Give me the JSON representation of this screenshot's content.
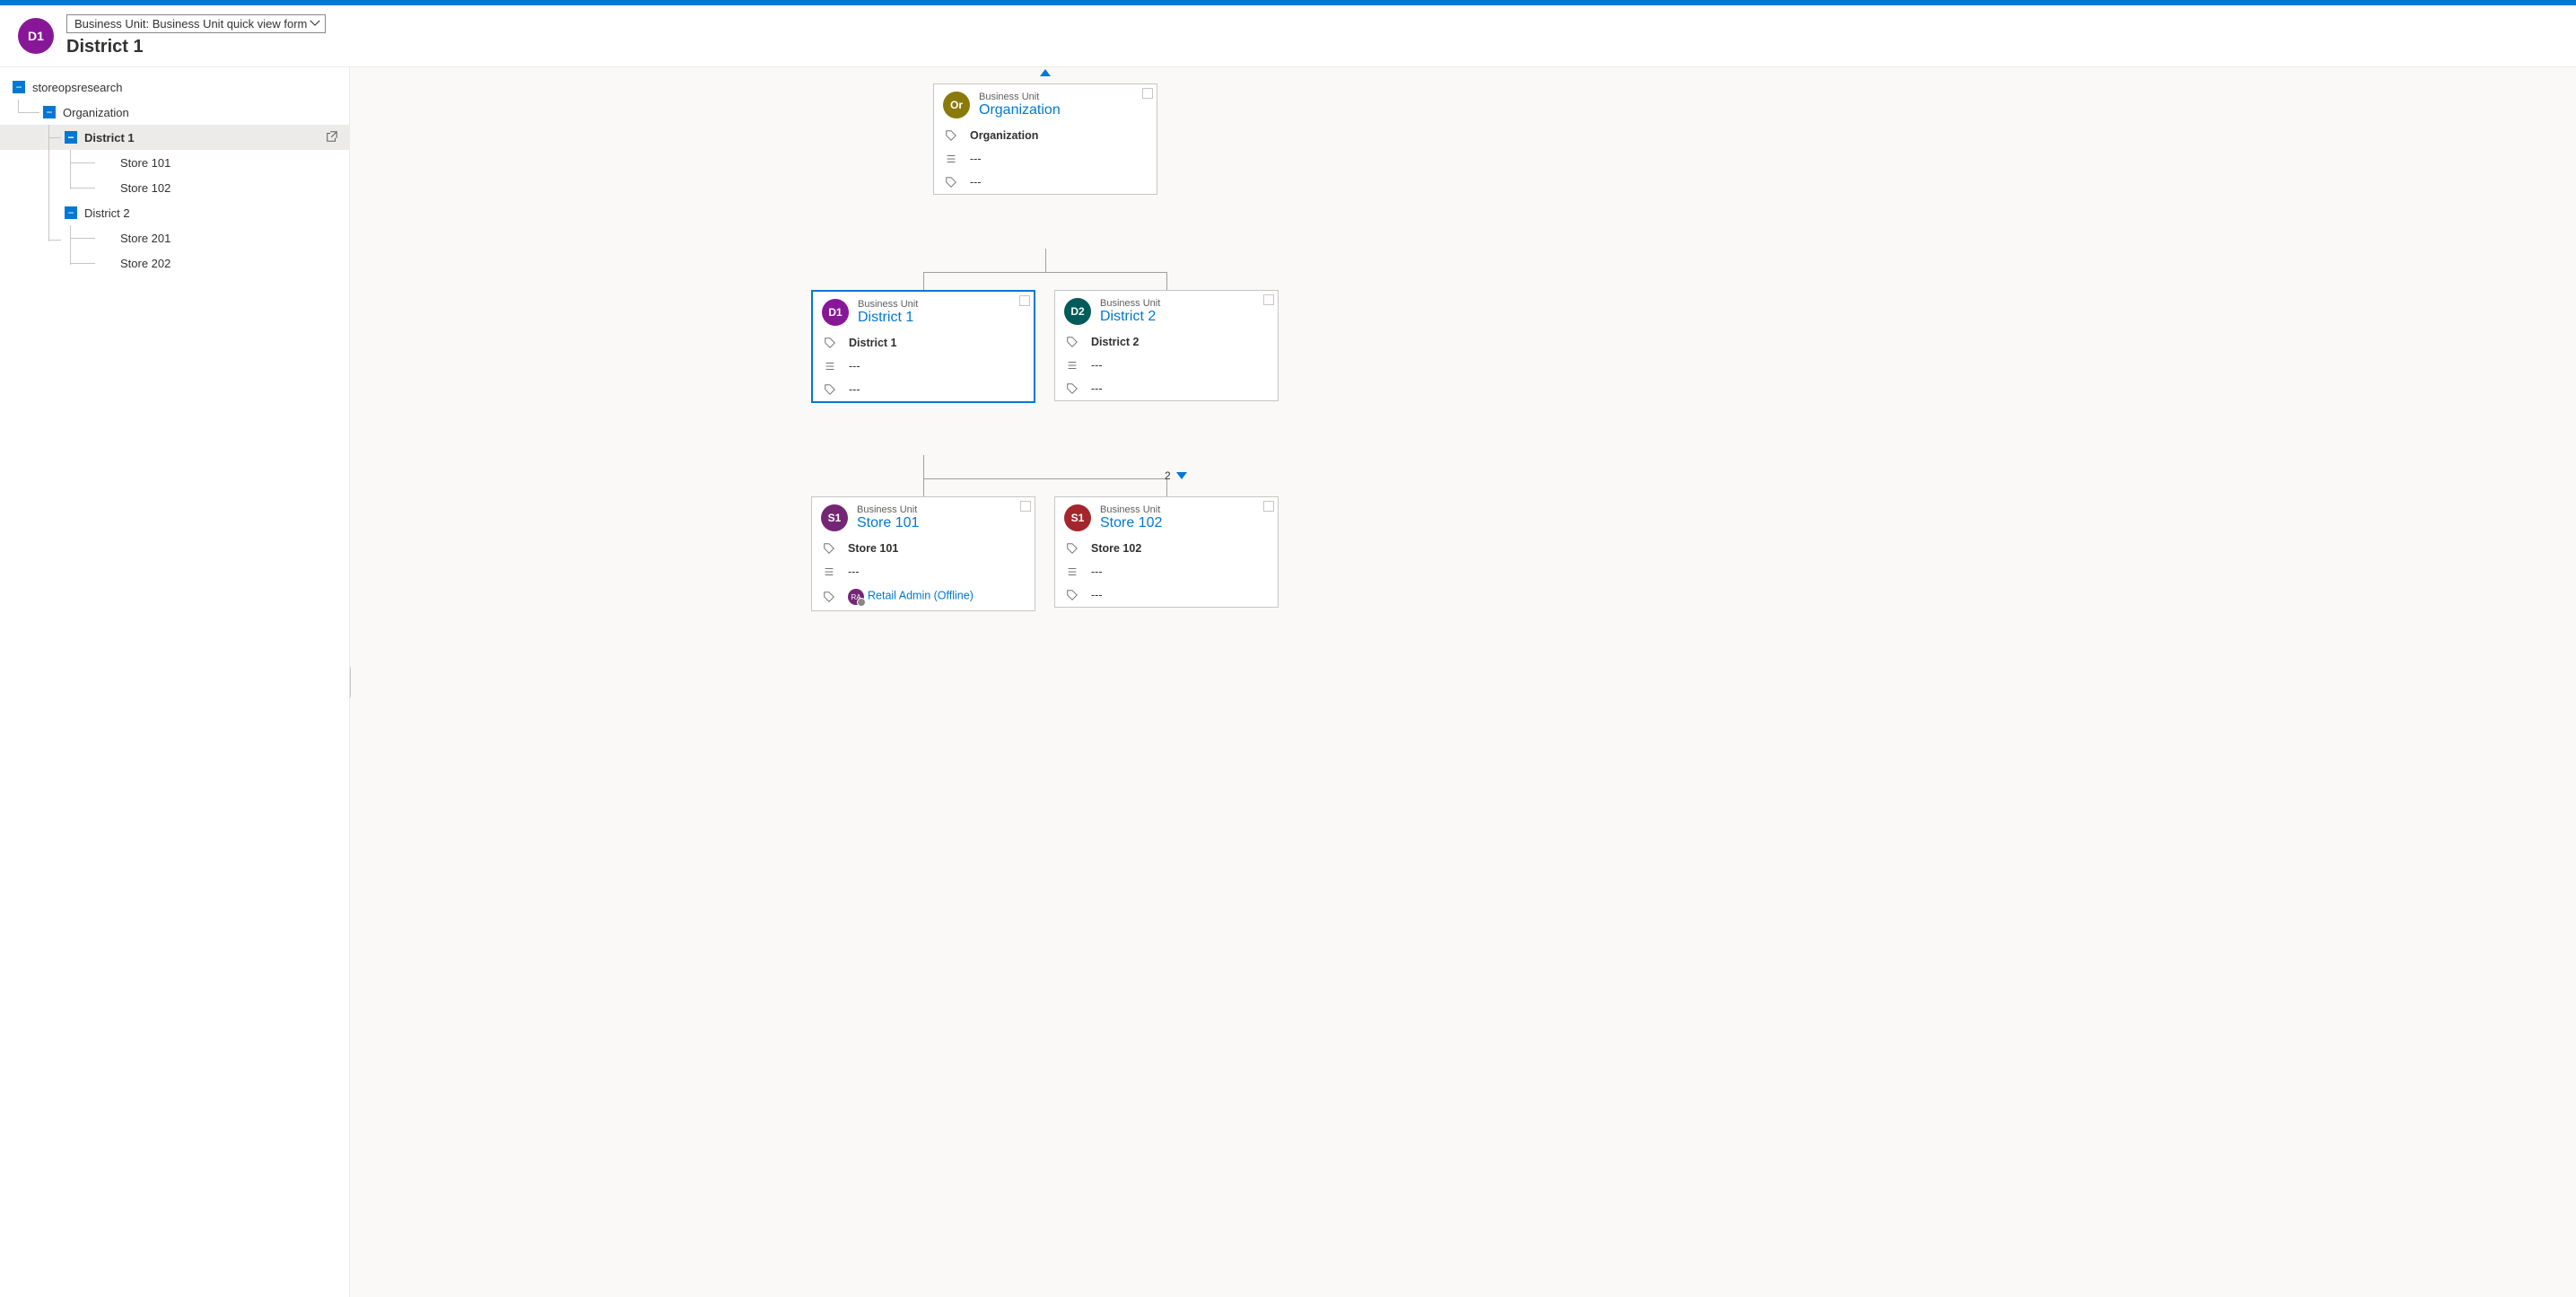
{
  "colors": {
    "purple": "#881798",
    "olive": "#8a7a0a",
    "teal": "#005b5b",
    "maroon": "#742774",
    "darkred": "#a4262c"
  },
  "header": {
    "avatar_text": "D1",
    "avatar_bg": "#881798",
    "form_selector": "Business Unit: Business Unit quick view form",
    "title": "District 1"
  },
  "tree": {
    "root": "storeopsresearch",
    "l1": "Organization",
    "d1": "District 1",
    "d1_s1": "Store 101",
    "d1_s2": "Store 102",
    "d2": "District 2",
    "d2_s1": "Store 201",
    "d2_s2": "Store 202"
  },
  "chart": {
    "entity_type": "Business Unit",
    "child_count": "2",
    "empty": "---",
    "org": {
      "avatar": "Or",
      "avatar_bg": "#8a7a0a",
      "name": "Organization",
      "row1": "Organization"
    },
    "d1": {
      "avatar": "D1",
      "avatar_bg": "#881798",
      "name": "District 1",
      "row1": "District 1"
    },
    "d2": {
      "avatar": "D2",
      "avatar_bg": "#005b5b",
      "name": "District 2",
      "row1": "District 2"
    },
    "s101": {
      "avatar": "S1",
      "avatar_bg": "#742774",
      "name": "Store 101",
      "row1": "Store 101",
      "admin": "Retail Admin (Offline)"
    },
    "s102": {
      "avatar": "S1",
      "avatar_bg": "#a4262c",
      "name": "Store 102",
      "row1": "Store 102"
    }
  }
}
